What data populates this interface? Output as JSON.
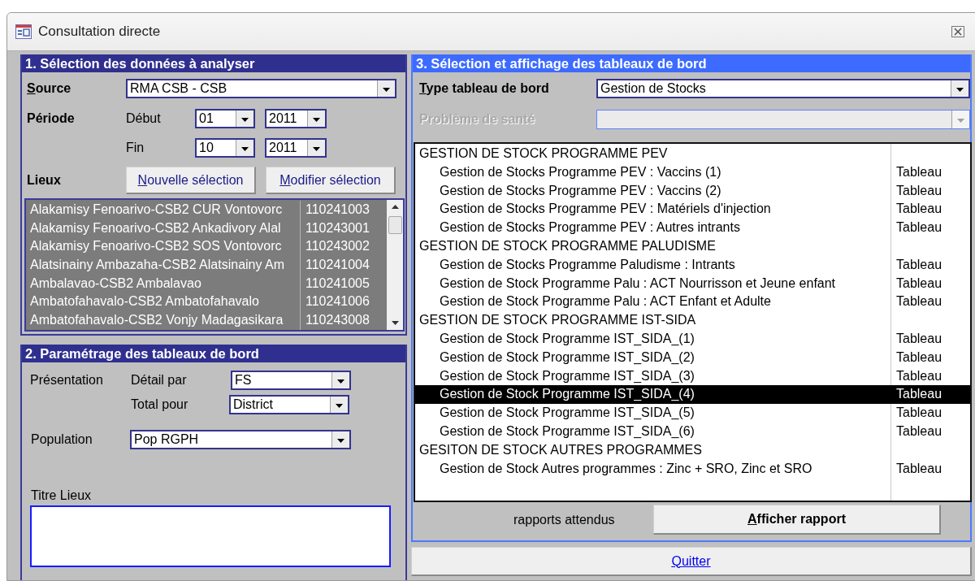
{
  "window": {
    "title": "Consultation directe"
  },
  "section1": {
    "title": "1. Sélection des données à analyser",
    "source": {
      "label": "Source",
      "value": "RMA CSB  -  CSB"
    },
    "periode": {
      "label": "Période",
      "start_label": "Début",
      "start_month": "01",
      "start_year": "2011",
      "end_label": "Fin",
      "end_month": "10",
      "end_year": "2011"
    },
    "lieux": {
      "label": "Lieux",
      "buttons": [
        "Nouvelle sélection",
        "Modifier sélection"
      ],
      "rows": [
        {
          "name": "Alakamisy Fenoarivo-CSB2 CUR Vontovorc",
          "code": "110241003",
          "selected": true
        },
        {
          "name": "Alakamisy Fenoarivo-CSB2 Ankadivory Alal",
          "code": "110243001",
          "selected": true
        },
        {
          "name": "Alakamisy Fenoarivo-CSB2 SOS Vontovorc",
          "code": "110243002",
          "selected": true
        },
        {
          "name": "Alatsinainy Ambazaha-CSB2 Alatsinainy Am",
          "code": "110241004",
          "selected": true
        },
        {
          "name": "Ambalavao-CSB2 Ambalavao",
          "code": "110241005",
          "selected": true
        },
        {
          "name": "Ambatofahavalo-CSB2 Ambatofahavalo",
          "code": "110241006",
          "selected": true
        },
        {
          "name": "Ambatofahavalo-CSB2 Vonjy Madagasikara",
          "code": "110243008",
          "selected": true
        }
      ]
    }
  },
  "section2": {
    "title": "2. Paramétrage des tableaux de bord",
    "presentation_label": "Présentation",
    "detail_label": "Détail par",
    "detail_value": "FS",
    "total_label": "Total pour",
    "total_value": "District",
    "population_label": "Population",
    "population_value": "Pop RGPH",
    "titre_label": "Titre Lieux"
  },
  "section3": {
    "title": "3. Sélection et affichage des tableaux de bord",
    "type": {
      "label": "Type tableau de bord",
      "value": "Gestion de Stocks",
      "disabled": false
    },
    "probleme": {
      "label": "Problème de santé",
      "disabled": true
    },
    "items": [
      {
        "kind": "group",
        "label": "GESTION DE STOCK PROGRAMME PEV"
      },
      {
        "kind": "item",
        "label": "Gestion de Stocks Programme PEV : Vaccins (1)",
        "type": "Tableau",
        "selected": false
      },
      {
        "kind": "item",
        "label": "Gestion de Stocks Programme PEV : Vaccins (2)",
        "type": "Tableau",
        "selected": false
      },
      {
        "kind": "item",
        "label": "Gestion de Stocks Programme PEV : Matériels d'injection",
        "type": "Tableau",
        "selected": false
      },
      {
        "kind": "item",
        "label": "Gestion de Stocks Programme PEV : Autres intrants",
        "type": "Tableau",
        "selected": false
      },
      {
        "kind": "group",
        "label": "GESTION DE STOCK PROGRAMME PALUDISME"
      },
      {
        "kind": "item",
        "label": "Gestion de Stocks Programme Paludisme : Intrants",
        "type": "Tableau",
        "selected": false
      },
      {
        "kind": "item",
        "label": "Gestion de Stock Programme Palu : ACT Nourrisson et Jeune enfant",
        "type": "Tableau",
        "selected": false
      },
      {
        "kind": "item",
        "label": "Gestion de Stock Programme Palu : ACT Enfant et Adulte",
        "type": "Tableau",
        "selected": false
      },
      {
        "kind": "group",
        "label": "GESTION DE STOCK PROGRAMME IST-SIDA"
      },
      {
        "kind": "item",
        "label": "Gestion de Stock Programme IST_SIDA_(1)",
        "type": "Tableau",
        "selected": false
      },
      {
        "kind": "item",
        "label": "Gestion de Stock Programme IST_SIDA_(2)",
        "type": "Tableau",
        "selected": false
      },
      {
        "kind": "item",
        "label": "Gestion de Stock Programme IST_SIDA_(3)",
        "type": "Tableau",
        "selected": false
      },
      {
        "kind": "item",
        "label": "Gestion de Stock Programme IST_SIDA_(4)",
        "type": "Tableau",
        "selected": true
      },
      {
        "kind": "item",
        "label": "Gestion de Stock Programme IST_SIDA_(5)",
        "type": "Tableau",
        "selected": false
      },
      {
        "kind": "item",
        "label": "Gestion de Stock Programme IST_SIDA_(6)",
        "type": "Tableau",
        "selected": false
      },
      {
        "kind": "group",
        "label": "GESITON DE STOCK AUTRES PROGRAMMES"
      },
      {
        "kind": "item",
        "label": "Gestion de Stock Autres programmes : Zinc + SRO, Zinc et SRO",
        "type": "Tableau",
        "selected": false
      }
    ],
    "expected_label": "rapports attendus",
    "show_button": "Afficher rapport"
  },
  "quit_button": "Quitter"
}
